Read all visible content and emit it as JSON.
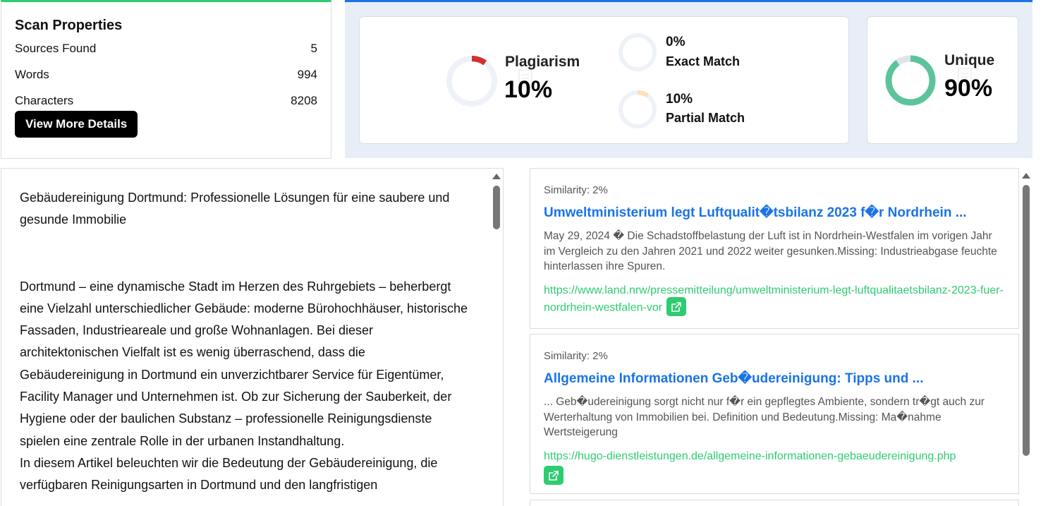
{
  "scan": {
    "title": "Scan Properties",
    "rows": [
      {
        "label": "Sources Found",
        "value": "5"
      },
      {
        "label": "Words",
        "value": "994"
      },
      {
        "label": "Characters",
        "value": "8208"
      }
    ],
    "details_button": "View More Details"
  },
  "stats": {
    "plagiarism_label": "Plagiarism",
    "plagiarism_value": "10%",
    "plagiarism_fraction": 0.1,
    "exact_value": "0%",
    "exact_label": "Exact Match",
    "exact_fraction": 0,
    "partial_value": "10%",
    "partial_label": "Partial Match",
    "partial_fraction": 0.1,
    "unique_label": "Unique",
    "unique_value": "90%",
    "unique_fraction": 0.9,
    "colors": {
      "plagiarism": "#d32f2f",
      "partial": "#ffe0b2",
      "unique": "#5cc49a",
      "ring_track": "#eef2f8",
      "unique_track": "#dfe4ea"
    }
  },
  "text_panel": {
    "title_line": "Gebäudereinigung Dortmund: Professionelle Lösungen für eine saubere und gesunde Immobilie",
    "paragraph1": "Dortmund – eine dynamische Stadt im Herzen des Ruhrgebiets – beherbergt eine Vielzahl unterschiedlicher Gebäude: moderne Bürohochhäuser, historische Fassaden, Industrieareale und große Wohnanlagen. Bei dieser architektonischen Vielfalt ist es wenig überraschend, dass die Gebäudereinigung in Dortmund ein unverzichtbarer Service für Eigentümer, Facility Manager und Unternehmen ist. Ob zur Sicherung der Sauberkeit, der Hygiene oder der baulichen Substanz – professionelle Reinigungsdienste spielen eine zentrale Rolle in der urbanen Instandhaltung.",
    "paragraph2": "In diesem Artikel beleuchten wir die Bedeutung der Gebäudereinigung, die verfügbaren Reinigungsarten in Dortmund und den langfristigen"
  },
  "sources": [
    {
      "similarity": "Similarity: 2%",
      "title": "Umweltministerium legt Luftqualit�tsbilanz 2023 f�r Nordrhein ...",
      "snippet": "May 29, 2024 � Die Schadstoffbelastung der Luft ist in Nordrhein-Westfalen im vorigen Jahr im Vergleich zu den Jahren 2021 und 2022 weiter gesunken.Missing: Industrieabgase feuchte hinterlassen ihre Spuren.",
      "url": "https://www.land.nrw/pressemitteilung/umweltministerium-legt-luftqualitaetsbilanz-2023-fuer-nordrhein-westfalen-vor"
    },
    {
      "similarity": "Similarity: 2%",
      "title": "Allgemeine Informationen Geb�udereinigung: Tipps und ...",
      "snippet": "... Geb�udereinigung sorgt nicht nur f�r ein gepflegtes Ambiente, sondern tr�gt auch zur Werterhaltung von Immobilien bei. Definition und Bedeutung.Missing: Ma�nahme Wertsteigerung",
      "url": "https://hugo-dienstleistungen.de/allgemeine-informationen-gebaeudereinigung.php"
    }
  ],
  "icons": {
    "external_link": "external-link-icon",
    "document_watermark": "document-icon"
  }
}
